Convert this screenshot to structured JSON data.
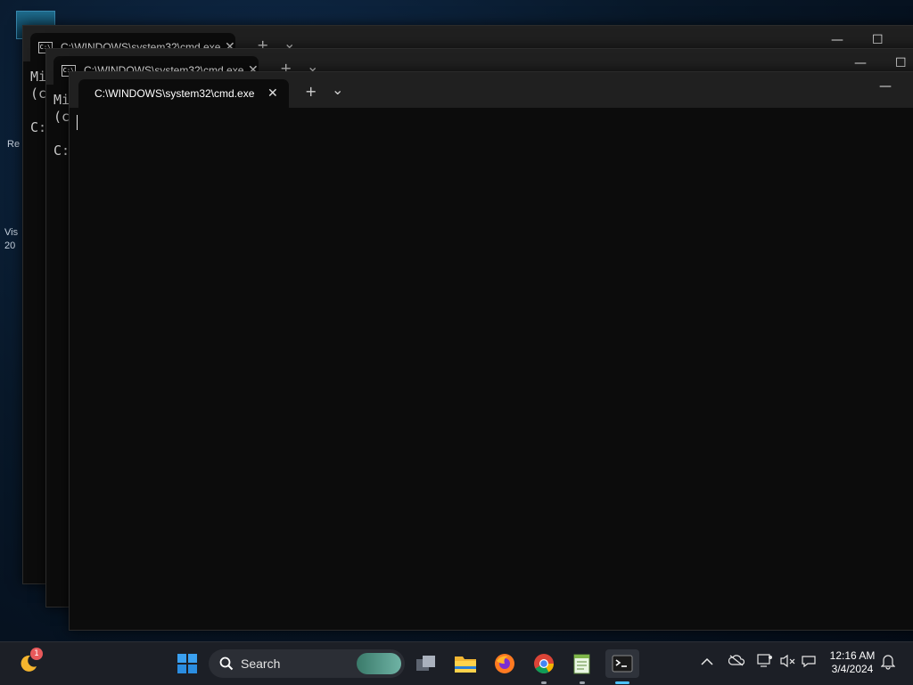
{
  "desktop": {
    "partial_texts": [
      "Re",
      "Vis",
      "20"
    ]
  },
  "windows": [
    {
      "tab_title": "C:\\WINDOWS\\system32\\cmd.exe",
      "console_lines": [
        "Mi",
        "(c",
        "",
        "C:"
      ]
    },
    {
      "tab_title": "C:\\WINDOWS\\system32\\cmd.exe",
      "console_lines": [
        "Mi",
        "(c",
        "",
        "C:"
      ]
    },
    {
      "tab_title": "C:\\WINDOWS\\system32\\cmd.exe",
      "console_lines": []
    }
  ],
  "window_controls": {
    "minimize": "—",
    "maximize": "☐",
    "close": "✕",
    "new_tab": "+",
    "dropdown": "⌄"
  },
  "taskbar": {
    "weather_badge": "1",
    "search_placeholder": "Search",
    "clock_time": "12:16 AM",
    "clock_date": "3/4/2024",
    "icons": [
      "weather-icon",
      "start-icon",
      "search-icon",
      "task-view-icon",
      "file-explorer-icon",
      "firefox-icon",
      "chrome-icon",
      "notepad-icon",
      "terminal-icon",
      "chevron-up-icon",
      "onedrive-icon",
      "network-icon",
      "volume-icon",
      "copilot-icon",
      "notification-bell-icon"
    ]
  },
  "colors": {
    "accent": "#0078d4",
    "console_bg": "#0c0c0c",
    "titlebar_bg": "#202020",
    "taskbar_bg": "#1c1f26"
  }
}
